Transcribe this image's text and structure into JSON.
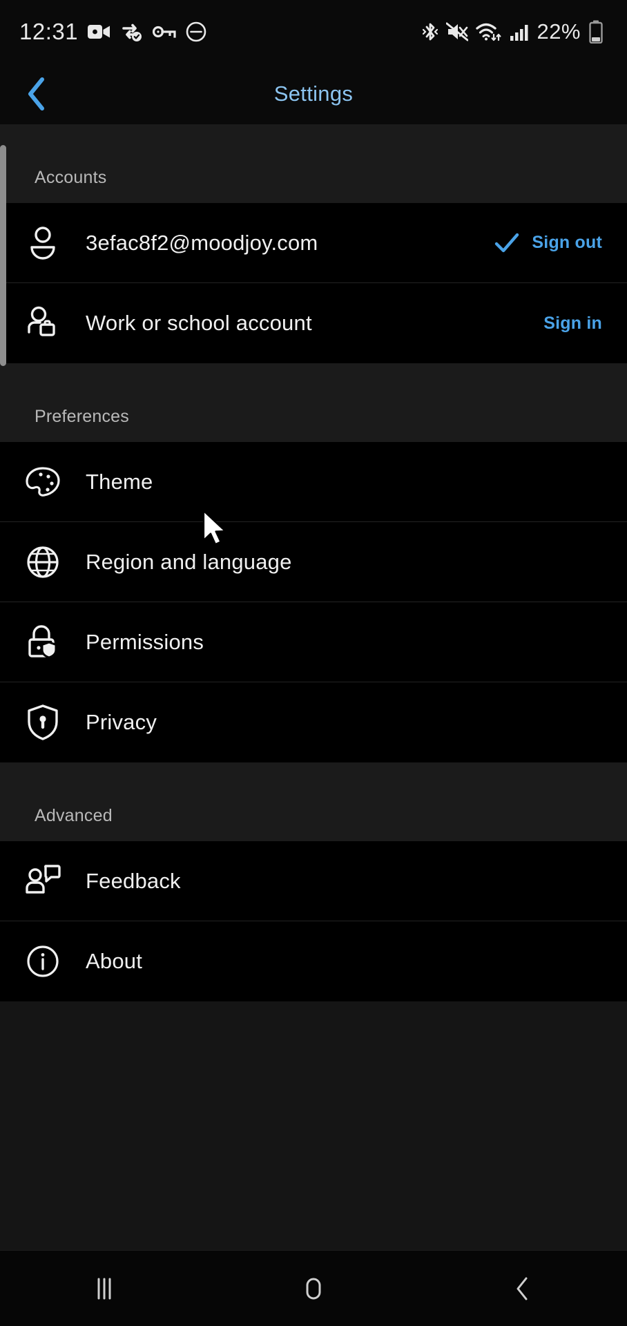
{
  "status_bar": {
    "time": "12:31",
    "battery_percent": "22%",
    "left_icons": [
      "video-camera-icon",
      "vpn-sync-icon",
      "key-icon",
      "do-not-disturb-icon"
    ],
    "right_icons": [
      "bluetooth-icon",
      "volume-muted-icon",
      "wifi-icon",
      "cellular-signal-icon",
      "battery-icon"
    ]
  },
  "app_bar": {
    "back_label": "Back",
    "title": "Settings",
    "title_color": "#8cc4f0"
  },
  "sections": [
    {
      "header": "Accounts",
      "items": [
        {
          "label": "3efac8f2@moodjoy.com",
          "icon": "person-icon",
          "action": "Sign out",
          "action_has_check": true
        },
        {
          "label": "Work or school account",
          "icon": "work-account-icon",
          "action": "Sign in",
          "action_has_check": false
        }
      ]
    },
    {
      "header": "Preferences",
      "items": [
        {
          "label": "Theme",
          "icon": "palette-icon",
          "action": "",
          "action_has_check": false
        },
        {
          "label": "Region and language",
          "icon": "globe-icon",
          "action": "",
          "action_has_check": false
        },
        {
          "label": "Permissions",
          "icon": "lock-shield-icon",
          "action": "",
          "action_has_check": false
        },
        {
          "label": "Privacy",
          "icon": "shield-keyhole-icon",
          "action": "",
          "action_has_check": false
        }
      ]
    },
    {
      "header": "Advanced",
      "items": [
        {
          "label": "Feedback",
          "icon": "feedback-icon",
          "action": "",
          "action_has_check": false
        },
        {
          "label": "About",
          "icon": "info-circle-icon",
          "action": "",
          "action_has_check": false
        }
      ]
    }
  ],
  "nav_bar": {
    "recents_label": "Recents",
    "home_label": "Home",
    "back_label": "Back"
  },
  "colors": {
    "accent": "#4aa3e8",
    "title": "#8cc4f0",
    "row_bg": "#000000",
    "section_bg": "#1b1b1b",
    "page_bg": "#151515"
  }
}
